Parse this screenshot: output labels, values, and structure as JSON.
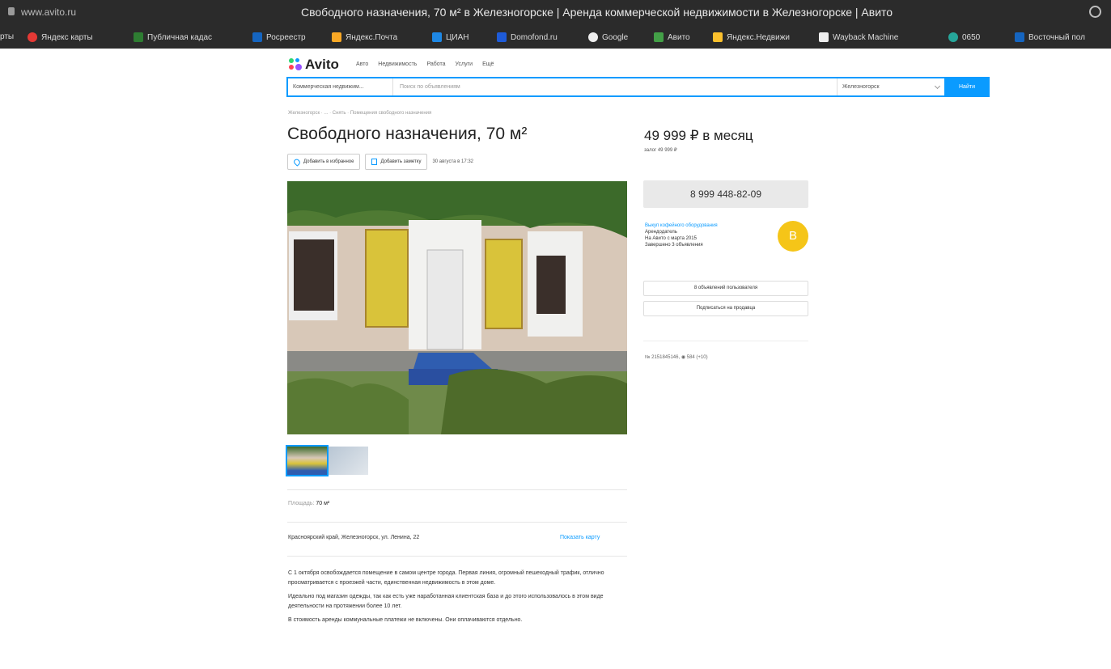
{
  "browser": {
    "url": "www.avito.ru",
    "title": "Свободного назначения, 70 м² в Железногорске | Аренда коммерческой недвижимости в Железногорске | Авито",
    "bookmarks": [
      {
        "label": "рты",
        "color": "#2b2b2b"
      },
      {
        "label": "Яндекс карты",
        "color": "#e53935"
      },
      {
        "label": "Публичная кадас",
        "color": "#2e7d32"
      },
      {
        "label": "Росреестр",
        "color": "#1565c0"
      },
      {
        "label": "Яндекс.Почта",
        "color": "#f9a825"
      },
      {
        "label": "ЦИАН",
        "color": "#1e88e5"
      },
      {
        "label": "Domofond.ru",
        "color": "#1e5bd8"
      },
      {
        "label": "Google",
        "color": "#eeeeee"
      },
      {
        "label": "Авито",
        "color": "#43a047"
      },
      {
        "label": "Яндекс.Недвижи",
        "color": "#fbc02d"
      },
      {
        "label": "Wayback Machine",
        "color": "#eeeeee"
      },
      {
        "label": "0650",
        "color": "#26a69a"
      },
      {
        "label": "Восточный пол",
        "color": "#1565c0"
      }
    ]
  },
  "site": {
    "logo": "Avito",
    "nav": [
      "Авто",
      "Недвижимость",
      "Работа",
      "Услуги",
      "Ещё"
    ]
  },
  "search": {
    "category": "Коммерческая недвижим...",
    "placeholder": "Поиск по объявлениям",
    "location": "Железногорск",
    "button": "Найти"
  },
  "listing": {
    "breadcrumbs": "Железногорск · ... · Снять · Помещения свободного назначения",
    "title": "Свободного назначения, 70 м²",
    "favorite_label": "Добавить в избранное",
    "note_label": "Добавить заметку",
    "date": "30 августа в 17:32",
    "area_label": "Площадь:",
    "area_value": "70 м²",
    "address": "Красноярский край, Железногорск, ул. Ленина, 22",
    "show_map": "Показать карту",
    "description": [
      "С 1 октября освобождается помещение в самом центре города. Первая линия, огромный пешеходный трафик, отлично просматривается с проезжей части, единственная недвижимость в этом доме.",
      "Идеально под магазин одежды, так как есть уже наработанная клиентская база и до этого использовалось в этом виде деятельности на протяжении более 10 лет.",
      "В стоимость аренды коммунальные платежи не включены. Они оплачиваются отдельно."
    ]
  },
  "sidebar": {
    "price": "49 999 ₽ в месяц",
    "deposit": "залог 49 999 ₽",
    "phone": "8 999 448-82-09",
    "seller_name": "Выкуп кофейного оборудования",
    "seller_role": "Арендодатель",
    "seller_since": "На Авито с марта 2015",
    "seller_done": "Завершено 3 объявления",
    "avatar_letter": "В",
    "user_ads_button": "8 объявлений пользователя",
    "subscribe_button": "Подписаться на продавца",
    "ad_number": "№ 2151845146",
    "views": "584 (+10)"
  },
  "colors": {
    "accent": "#0a9bff",
    "avatar": "#f5c518"
  }
}
